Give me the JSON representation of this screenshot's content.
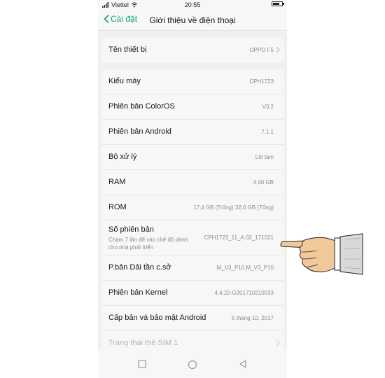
{
  "status": {
    "carrier": "Viettel",
    "time": "20:55"
  },
  "nav": {
    "back_label": "Cài đặt",
    "title": "Giới thiệu về điện thoại"
  },
  "device_name": {
    "label": "Tên thiết bị",
    "value": "OPPO F5"
  },
  "info_rows": [
    {
      "label": "Kiểu máy",
      "value": "CPH1723"
    },
    {
      "label": "Phiên bản ColorOS",
      "value": "V3.2"
    },
    {
      "label": "Phiên bản Android",
      "value": "7.1.1"
    },
    {
      "label": "Bộ xử lý",
      "value": "Lõi tám"
    },
    {
      "label": "RAM",
      "value": "4,00 GB"
    },
    {
      "label": "ROM",
      "value": "17,4 GB (Trống)  32,0 GB (Tổng)"
    },
    {
      "label": "Số phiên bản",
      "sub": "Chạm 7 lần để vào chế độ dành cho nhà phát triển",
      "value": "CPH1723_11_A.02_171021"
    },
    {
      "label": "P.bản Dải tần c.sở",
      "value": "M_V3_P10,M_V3_P10"
    },
    {
      "label": "Phiên bản Kernel",
      "value": "4.4.22-G201710210033"
    },
    {
      "label": "Cấp bản vá bảo mật Android",
      "value": "5 tháng 10, 2017"
    },
    {
      "label": "Trạng thái thẻ SIM 1",
      "value": ""
    }
  ],
  "colors": {
    "accent": "#0aa36e",
    "background": "#f0f0f0",
    "card": "#f7f7f7"
  },
  "icons": {
    "back": "chevron-left-icon",
    "recents": "square-icon",
    "home": "circle-icon",
    "back_nav": "triangle-back-icon",
    "pointer": "pointing-hand-icon"
  }
}
